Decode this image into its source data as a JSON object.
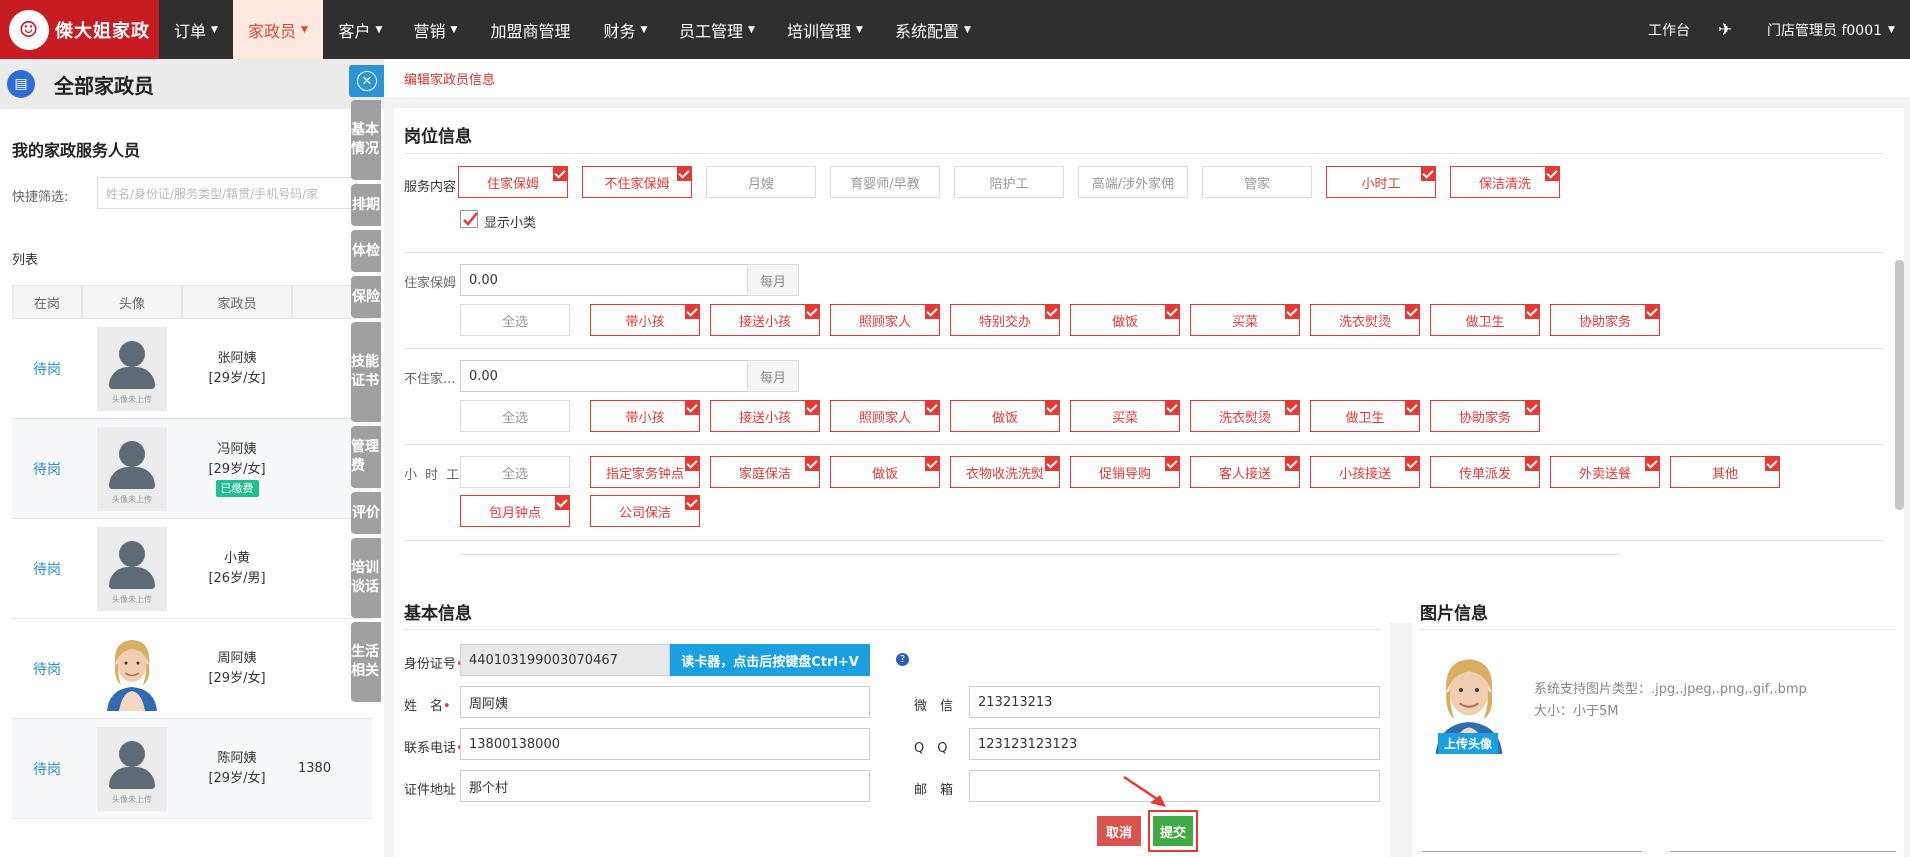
{
  "brand": {
    "logo_text": "傑大姐家政",
    "logo_face": "☺"
  },
  "nav": [
    {
      "label": "订单",
      "caret": "▼"
    },
    {
      "label": "家政员",
      "caret": "▼"
    },
    {
      "label": "客户",
      "caret": "▼"
    },
    {
      "label": "营销",
      "caret": "▼"
    },
    {
      "label": "加盟商管理",
      "caret": ""
    },
    {
      "label": "财务",
      "caret": "▼"
    },
    {
      "label": "员工管理",
      "caret": "▼"
    },
    {
      "label": "培训管理",
      "caret": "▼"
    },
    {
      "label": "系统配置",
      "caret": "▼"
    }
  ],
  "topright": {
    "workbench": "工作台",
    "flag_icon": "✈",
    "user": "门店管理员 f0001",
    "user_caret": "▼"
  },
  "left": {
    "page_title": "全部家政员",
    "book_icon": "▤",
    "card_title": "我的家政服务人员",
    "quick_label": "快捷筛选:",
    "quick_placeholder": "姓名/身份证/服务类型/籍贯/手机号码/家",
    "list_label": "列表",
    "columns": [
      "在岗",
      "头像",
      "家政员"
    ],
    "avatar_placeholder": "头像未上传",
    "rows": [
      {
        "status": "待岗",
        "name": "张阿姨",
        "info": "[29岁/女]",
        "badge": "",
        "extra": ""
      },
      {
        "status": "待岗",
        "name": "冯阿姨",
        "info": "[29岁/女]",
        "badge": "已缴费",
        "extra": ""
      },
      {
        "status": "待岗",
        "name": "小黄",
        "info": "[26岁/男]",
        "badge": "",
        "extra": ""
      },
      {
        "status": "待岗",
        "name": "周阿姨",
        "info": "[29岁/女]",
        "badge": "",
        "extra": ""
      },
      {
        "status": "待岗",
        "name": "陈阿姨",
        "info": "[29岁/女]",
        "badge": "",
        "extra": "1380"
      }
    ]
  },
  "vtabs": {
    "close_icon": "✕",
    "items": [
      "基本情况",
      "排期",
      "体检",
      "保险",
      "技能证书",
      "管理费",
      "评价",
      "培训谈话",
      "生活相关"
    ]
  },
  "editor": {
    "breadcrumb": "编辑家政员信息",
    "position": {
      "title": "岗位信息",
      "service_label": "服务内容",
      "req": "•",
      "services": [
        {
          "label": "住家保姆",
          "checked": true
        },
        {
          "label": "不住家保姆",
          "checked": true
        },
        {
          "label": "月嫂",
          "checked": false
        },
        {
          "label": "育婴师/早教",
          "checked": false
        },
        {
          "label": "陪护工",
          "checked": false
        },
        {
          "label": "高端/涉外家佣",
          "checked": false
        },
        {
          "label": "管家",
          "checked": false
        },
        {
          "label": "小时工",
          "checked": true
        },
        {
          "label": "保洁清洗",
          "checked": true
        }
      ],
      "show_sub": "显示小类",
      "groups": [
        {
          "label": "住家保姆",
          "value": "0.00",
          "unit": "每月",
          "select_all": "全选",
          "items": [
            "带小孩",
            "接送小孩",
            "照顾家人",
            "特别交办",
            "做饭",
            "买菜",
            "洗衣熨烫",
            "做卫生",
            "协助家务"
          ]
        },
        {
          "label": "不住家...",
          "value": "0.00",
          "unit": "每月",
          "select_all": "全选",
          "items": [
            "带小孩",
            "接送小孩",
            "照顾家人",
            "做饭",
            "买菜",
            "洗衣熨烫",
            "做卫生",
            "协助家务"
          ]
        },
        {
          "label": "小 时 工",
          "select_all": "全选",
          "items": [
            "指定家务钟点",
            "家庭保洁",
            "做饭",
            "衣物收洗洗熨",
            "促销导购",
            "客人接送",
            "小孩接送",
            "传单派发",
            "外卖送餐",
            "其他",
            "包月钟点",
            "公司保洁"
          ]
        }
      ]
    },
    "basic": {
      "title": "基本信息",
      "id_label": "身份证号",
      "id_value": "440103199003070467",
      "read_card": "读卡器，点击后按键盘Ctrl+V",
      "help_icon": "?",
      "name_label": "姓　名",
      "name_value": "周阿姨",
      "wechat_label": "微　信",
      "wechat_value": "213213213",
      "phone_label": "联系电话",
      "phone_value": "13800138000",
      "qq_label": "Q　Q",
      "qq_value": "123123123123",
      "addr_label": "证件地址",
      "addr_value": "那个村",
      "email_label": "邮　箱",
      "email_value": ""
    },
    "photos": {
      "title": "图片信息",
      "types": "系统支持图片类型：.jpg,.jpeg,.png,.gif,.bmp",
      "size": "大小：小于5M",
      "upload": "上传头像"
    },
    "actions": {
      "cancel": "取消",
      "submit": "提交"
    },
    "colors": {
      "accent_red": "#e53935",
      "brand_red": "#c71d22",
      "blue": "#1aa0e0",
      "green": "#3fa946"
    }
  }
}
